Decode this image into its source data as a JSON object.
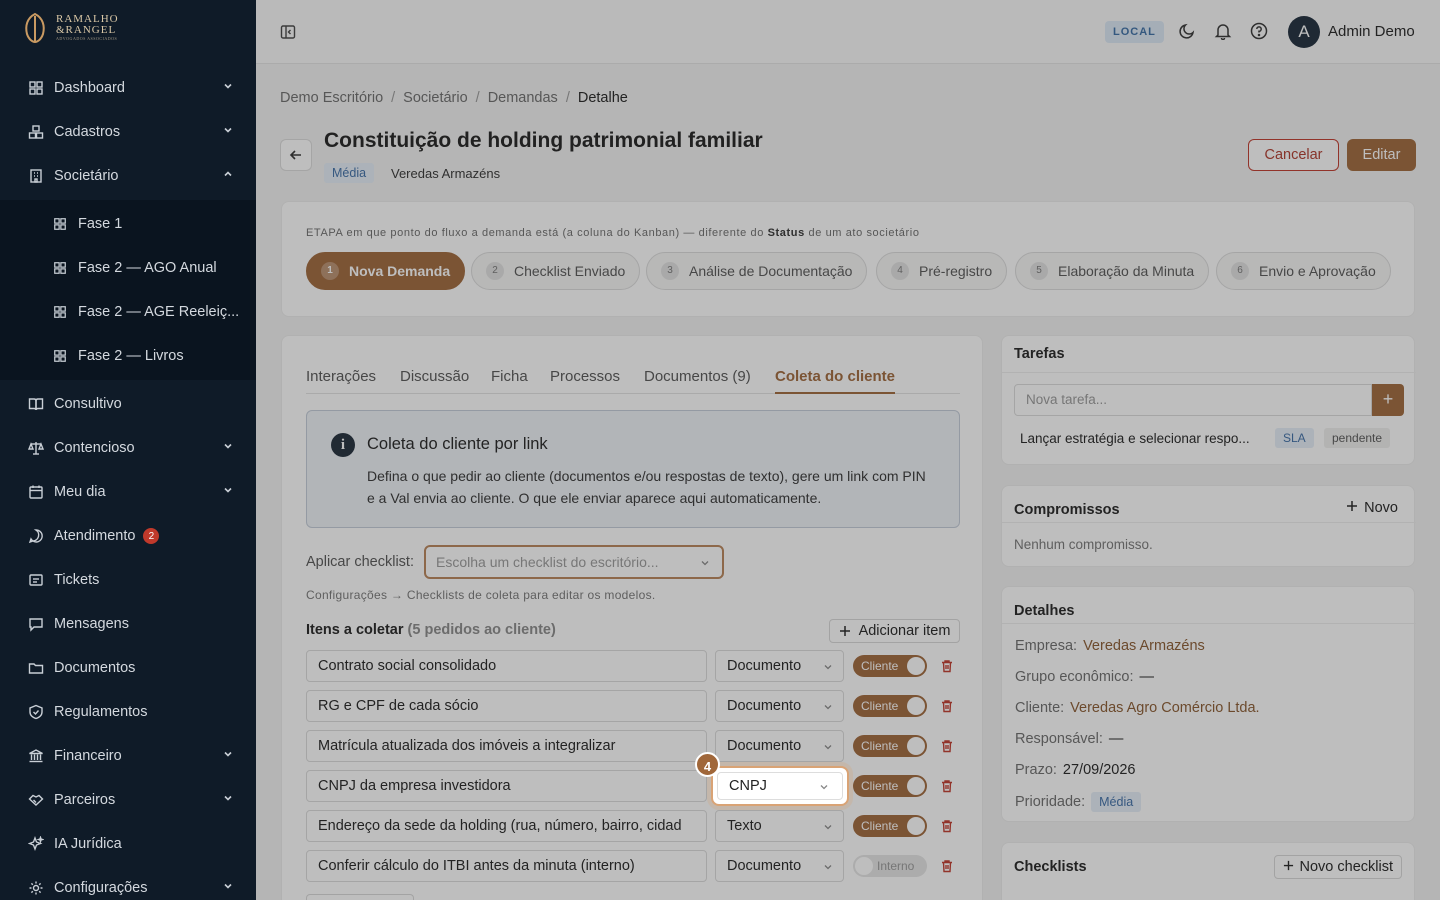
{
  "brand": {
    "logo_line1": "RAMALHO",
    "logo_line2": "&RANGEL",
    "logo_tag": "ADVOGADOS ASSOCIADOS"
  },
  "sidebar": {
    "items": [
      {
        "label": "Dashboard"
      },
      {
        "label": "Cadastros"
      },
      {
        "label": "Societário"
      },
      {
        "label": "Fase 1"
      },
      {
        "label": "Fase 2 — AGO Anual"
      },
      {
        "label": "Fase 2 — AGE Reeleiç..."
      },
      {
        "label": "Fase 2 — Livros"
      },
      {
        "label": "Consultivo"
      },
      {
        "label": "Contencioso"
      },
      {
        "label": "Meu dia"
      },
      {
        "label": "Atendimento",
        "badge": "2"
      },
      {
        "label": "Tickets"
      },
      {
        "label": "Mensagens"
      },
      {
        "label": "Documentos"
      },
      {
        "label": "Regulamentos"
      },
      {
        "label": "Financeiro"
      },
      {
        "label": "Parceiros"
      },
      {
        "label": "IA Jurídica"
      },
      {
        "label": "Configurações"
      }
    ]
  },
  "topbar": {
    "env": "LOCAL",
    "avatar_letter": "A",
    "user_name": "Admin Demo"
  },
  "breadcrumb": [
    "Demo Escritório",
    "Societário",
    "Demandas",
    "Detalhe"
  ],
  "header": {
    "title": "Constituição de holding patrimonial familiar",
    "priority": "Média",
    "company": "Veredas Armazéns",
    "cancel_label": "Cancelar",
    "edit_label": "Editar"
  },
  "stages": {
    "hint_prefix": "ETAPA",
    "hint_mid": "em que ponto do fluxo a demanda está (a coluna do Kanban) — diferente do",
    "hint_bold": "Status",
    "hint_suffix": "de um ato societário",
    "items": [
      {
        "num": "1",
        "label": "Nova Demanda"
      },
      {
        "num": "2",
        "label": "Checklist Enviado"
      },
      {
        "num": "3",
        "label": "Análise de Documentação"
      },
      {
        "num": "4",
        "label": "Pré-registro"
      },
      {
        "num": "5",
        "label": "Elaboração da Minuta"
      },
      {
        "num": "6",
        "label": "Envio e Aprovação"
      }
    ]
  },
  "tabs": [
    "Interações",
    "Discussão",
    "Ficha",
    "Processos",
    "Documentos (9)",
    "Coleta do cliente"
  ],
  "info": {
    "icon": "i",
    "title": "Coleta do cliente por link",
    "desc": "Defina o que pedir ao cliente (documentos e/ou respostas de texto), gere um link com PIN e a Val envia ao cliente. O que ele enviar aparece aqui automaticamente."
  },
  "apply": {
    "label": "Aplicar checklist:",
    "placeholder": "Escolha um checklist do escritório..."
  },
  "config_hint": "Configurações → Checklists de coleta para editar os modelos.",
  "items_head": {
    "title": "Itens a coletar",
    "count": "(5 pedidos ao cliente)",
    "add_label": "Adicionar item"
  },
  "rows": [
    {
      "text": "Contrato social consolidado",
      "type": "Documento",
      "who": "Cliente"
    },
    {
      "text": "RG e CPF de cada sócio",
      "type": "Documento",
      "who": "Cliente"
    },
    {
      "text": "Matrícula atualizada dos imóveis a integralizar",
      "type": "Documento",
      "who": "Cliente"
    },
    {
      "text": "CNPJ da empresa investidora",
      "type": "CNPJ",
      "who": "Cliente"
    },
    {
      "text": "Endereço da sede da holding (rua, número, bairro, cidad",
      "type": "Texto",
      "who": "Cliente"
    },
    {
      "text": "Conferir cálculo do ITBI antes da minuta (interno)",
      "type": "Documento",
      "who": "Interno"
    }
  ],
  "step_badge": "4",
  "tarefas": {
    "title": "Tarefas",
    "placeholder": "Nova tarefa...",
    "task": "Lançar estratégia e selecionar respo...",
    "tag1": "SLA",
    "tag2": "pendente"
  },
  "compromissos": {
    "title": "Compromissos",
    "novo": "Novo",
    "empty": "Nenhum compromisso."
  },
  "detalhes": {
    "title": "Detalhes",
    "rows": [
      {
        "k": "Empresa",
        "v": "Veredas Armazéns"
      },
      {
        "k": "Grupo econômico",
        "v": "—"
      },
      {
        "k": "Cliente",
        "v": "Veredas Agro Comércio Ltda."
      },
      {
        "k": "Responsável",
        "v": "—"
      },
      {
        "k": "Prazo",
        "v": "27/09/2026"
      },
      {
        "k": "Prioridade",
        "v": "Média"
      }
    ]
  },
  "checklists": {
    "title": "Checklists",
    "novo": "Novo checklist"
  },
  "colors": {
    "accent": "#a0673a",
    "sidebar": "#0f1b28",
    "danger": "#c0392b"
  }
}
